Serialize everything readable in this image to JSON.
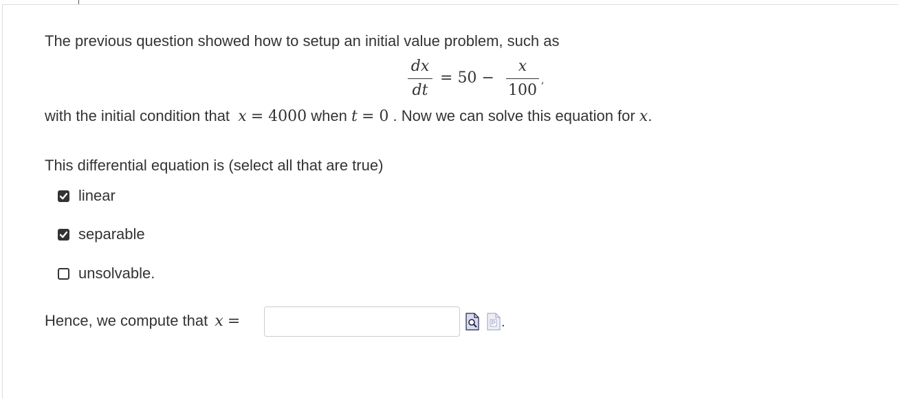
{
  "intro": {
    "sentence": "The previous question showed how to setup an initial value problem, such as"
  },
  "equation": {
    "lhs_numerator": "dx",
    "lhs_denominator": "dt",
    "equals": "=",
    "constant": "50",
    "minus": "−",
    "rhs_numerator": "x",
    "rhs_denominator": "100",
    "trailing_comma": ","
  },
  "condition": {
    "text_before": "with the initial condition that",
    "var_x": "x",
    "equals_value": "= 4000",
    "word_when": "when",
    "var_t": "t",
    "equals_zero": "= 0",
    "text_after": ". Now we can solve this equation for",
    "var_final": "x",
    "final_period": "."
  },
  "question": {
    "prompt": "This differential equation is (select all that are true)",
    "options": [
      {
        "label": "linear",
        "checked": true
      },
      {
        "label": "separable",
        "checked": true
      },
      {
        "label": "unsolvable.",
        "checked": false
      }
    ]
  },
  "answer": {
    "label": "Hence, we compute that",
    "var": "x",
    "equals": "=",
    "value": "",
    "trailing_period": "."
  },
  "icons": {
    "preview": "preview-icon",
    "help": "help-icon"
  },
  "colors": {
    "text": "#333333",
    "border": "#cccccc",
    "icon_fill": "#d8dcf0"
  }
}
